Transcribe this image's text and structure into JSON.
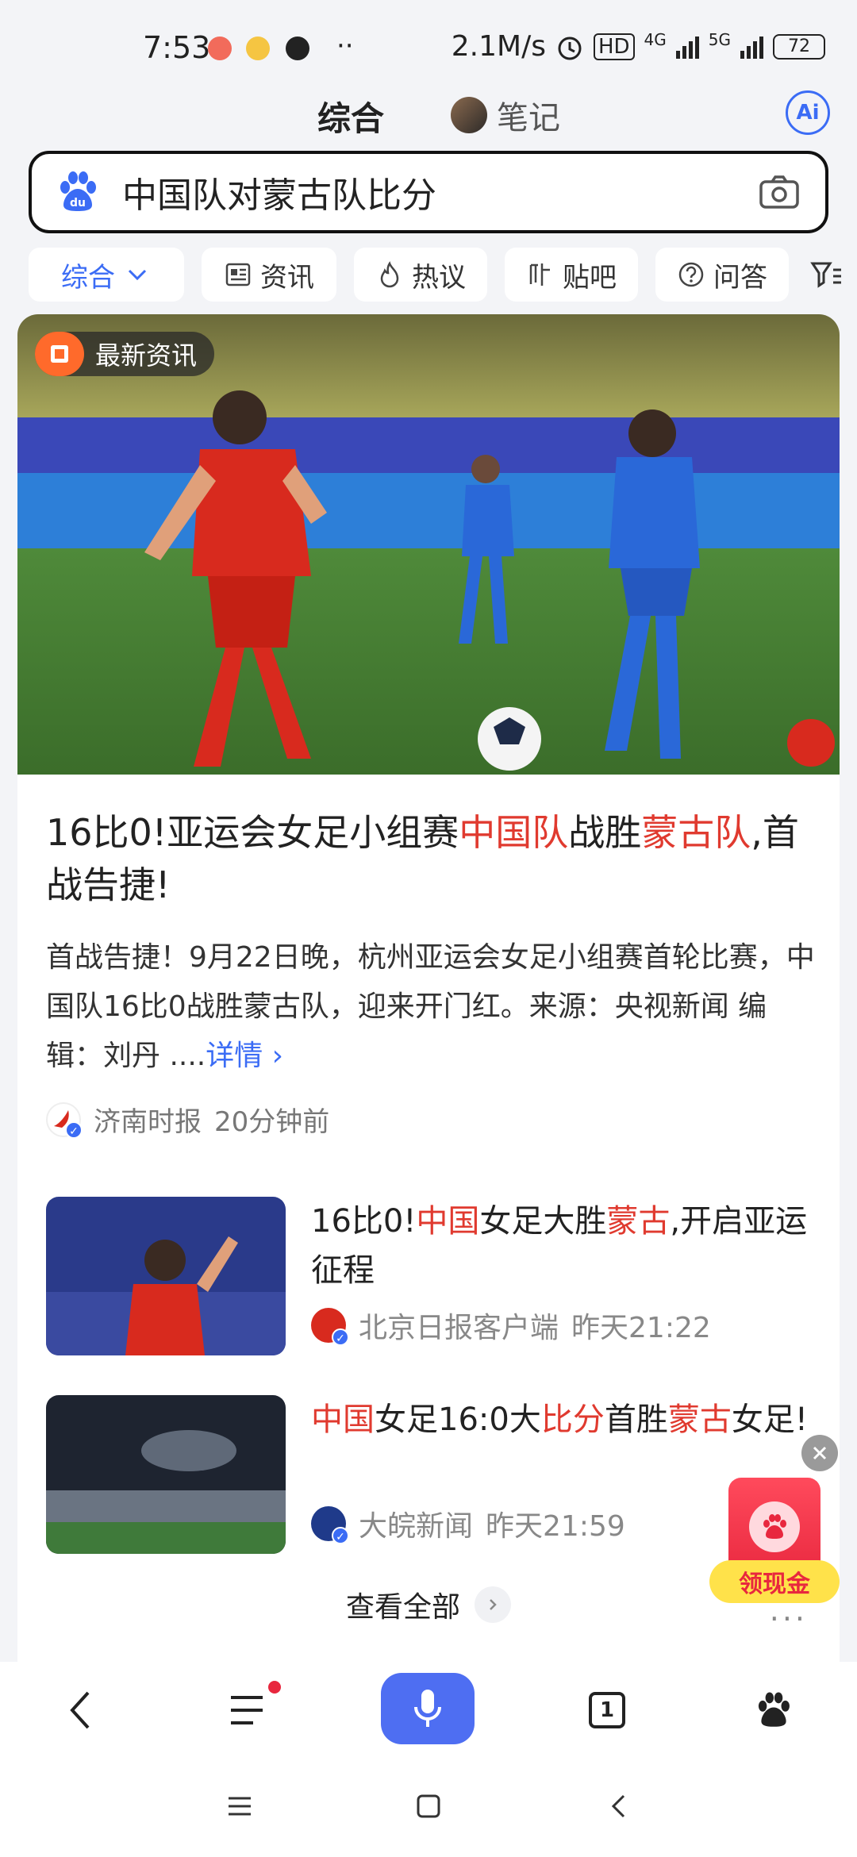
{
  "status_bar": {
    "time": "7:53",
    "more": "··",
    "network_speed": "2.1M/s",
    "hd_badge": "HD",
    "net_4g": "4G",
    "net_5g": "5G",
    "battery": "72"
  },
  "header": {
    "tab_main": "综合",
    "tab_notes": "笔记",
    "ai_label": "Ai"
  },
  "search": {
    "query": "中国队对蒙古队比分"
  },
  "filters": {
    "items": [
      {
        "label": "综合"
      },
      {
        "label": "资讯"
      },
      {
        "label": "热议"
      },
      {
        "label": "贴吧"
      },
      {
        "label": "问答"
      }
    ]
  },
  "top_story": {
    "badge": "最新资讯",
    "title_parts": [
      "16比0!亚运会女足小组赛",
      "中国队",
      "战胜",
      "蒙古队",
      ",首战告捷!"
    ],
    "summary": "首战告捷！9月22日晚，杭州亚运会女足小组赛首轮比赛，中国队16比0战胜蒙古队，迎来开门红。来源：央视新闻 编辑：刘丹 ....",
    "detail_link": "详情 ›",
    "source": "济南时报",
    "time": "20分钟前"
  },
  "news": [
    {
      "title_parts": [
        "16比0!",
        "中国",
        "女足大胜",
        "蒙古",
        ",开启亚运征程"
      ],
      "source": "北京日报客户端",
      "time": "昨天21:22"
    },
    {
      "title_parts": [
        "中国",
        "女足16:0大",
        "比分",
        "首胜",
        "蒙古",
        "女足!"
      ],
      "source": "大皖新闻",
      "time": "昨天21:59"
    }
  ],
  "view_all": "查看全部",
  "more_dots": "···",
  "red_packet": {
    "label": "领现金"
  },
  "bottom_nav": {
    "tab_count": "1"
  },
  "colors": {
    "accent_blue": "#4e6ef2",
    "highlight_red": "#e03a2f",
    "red_packet": "#e8273e"
  }
}
